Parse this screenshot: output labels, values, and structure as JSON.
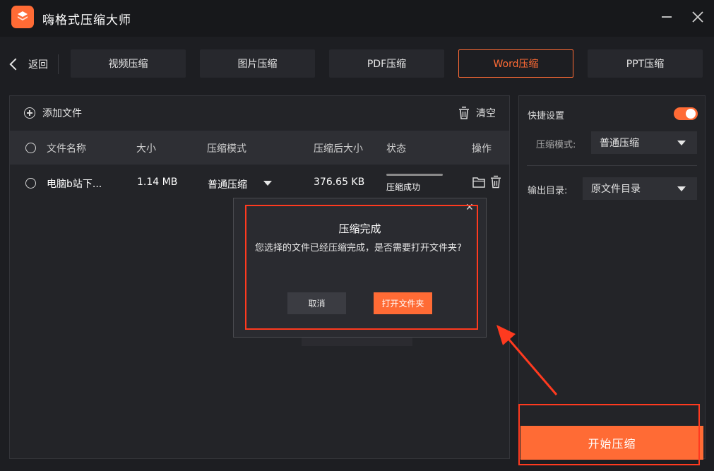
{
  "app": {
    "title": "嗨格式压缩大师"
  },
  "window": {
    "minimize_icon": "minimize-icon",
    "close_icon": "close-icon"
  },
  "nav": {
    "back_label": "返回",
    "tabs": [
      {
        "label": "视频压缩",
        "active": false
      },
      {
        "label": "图片压缩",
        "active": false
      },
      {
        "label": "PDF压缩",
        "active": false
      },
      {
        "label": "Word压缩",
        "active": true
      },
      {
        "label": "PPT压缩",
        "active": false
      }
    ]
  },
  "toolbar": {
    "add_file_label": "添加文件",
    "clear_label": "清空"
  },
  "table": {
    "headers": {
      "name": "文件名称",
      "size": "大小",
      "mode": "压缩模式",
      "after_size": "压缩后大小",
      "status": "状态",
      "actions": "操作"
    },
    "rows": [
      {
        "name": "电脑b站下...",
        "size": "1.14 MB",
        "mode": "普通压缩",
        "after_size": "376.65 KB",
        "status": "压缩成功",
        "progress": 1.0
      }
    ]
  },
  "settings": {
    "quick_settings_label": "快捷设置",
    "quick_settings_on": true,
    "compress_mode_label": "压缩模式:",
    "compress_mode_value": "普通压缩",
    "output_dir_label": "输出目录:",
    "output_dir_value": "原文件目录",
    "start_label": "开始压缩"
  },
  "dialog": {
    "title": "压缩完成",
    "message": "您选择的文件已经压缩完成，是否需要打开文件夹?",
    "close_glyph": "✕",
    "cancel_label": "取消",
    "open_folder_label": "打开文件夹"
  },
  "colors": {
    "accent": "#ff6b35",
    "annotation": "#ff3a1f",
    "background": "#1d1e22"
  }
}
